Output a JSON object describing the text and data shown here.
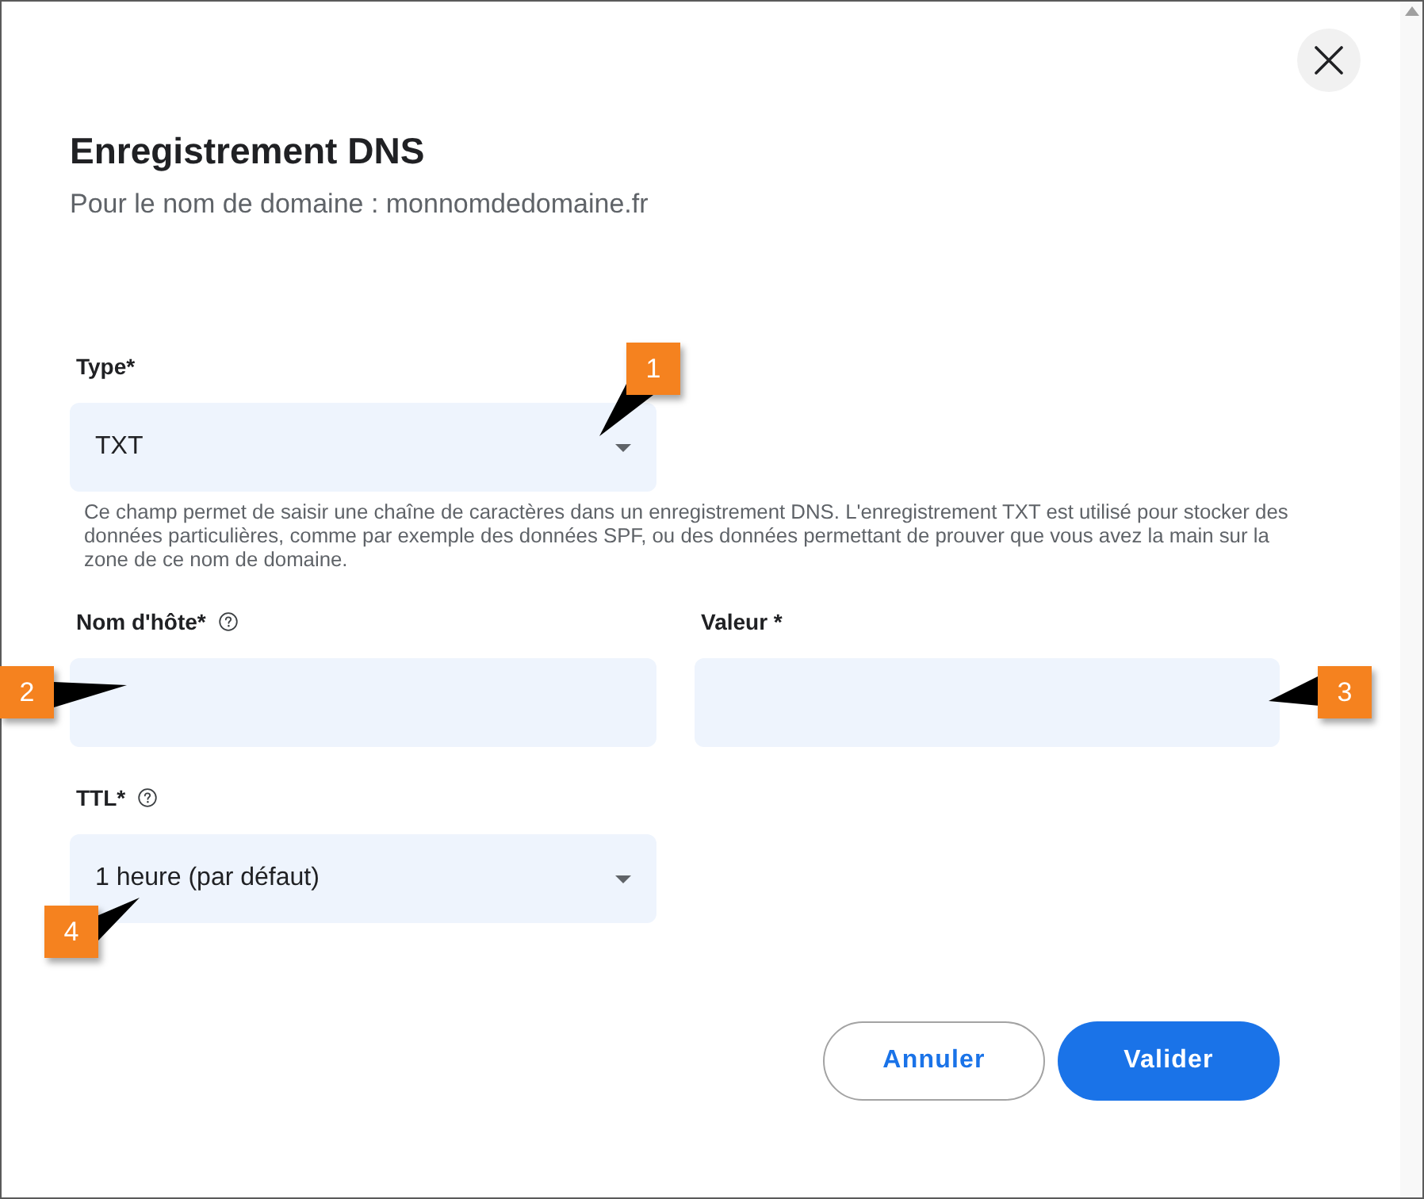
{
  "dialog": {
    "title": "Enregistrement DNS",
    "subtitle": "Pour le nom de domaine : monnomdedomaine.fr"
  },
  "form": {
    "rows": [
      {
        "fields": [
          {
            "kind": "select",
            "label": "Type*",
            "info_icon": false,
            "value": "TXT",
            "help": "Ce champ permet de saisir une chaîne de caractères dans un enregistrement DNS. L'enregistrement TXT est utilisé pour stocker des données particulières, comme par exemple des données SPF, ou des données permettant de prouver que vous avez la main sur la zone de ce nom de domaine.",
            "callout": {
              "number": "1",
              "kind": "top"
            }
          }
        ]
      },
      {
        "fields": [
          {
            "kind": "input",
            "label": "Nom d'hôte*",
            "info_icon": true,
            "callout": {
              "number": "2",
              "kind": "left"
            }
          },
          {
            "kind": "input",
            "label": "Valeur *",
            "info_icon": false,
            "callout": {
              "number": "3",
              "kind": "right"
            }
          }
        ]
      },
      {
        "fields": [
          {
            "kind": "select",
            "label": "TTL*",
            "info_icon": true,
            "value": "1 heure (par défaut)",
            "callout": {
              "number": "4",
              "kind": "bottom"
            }
          }
        ]
      }
    ]
  },
  "buttons": [
    {
      "label": "Annuler",
      "kind": "secondary"
    },
    {
      "label": "Valider",
      "kind": "primary"
    }
  ]
}
